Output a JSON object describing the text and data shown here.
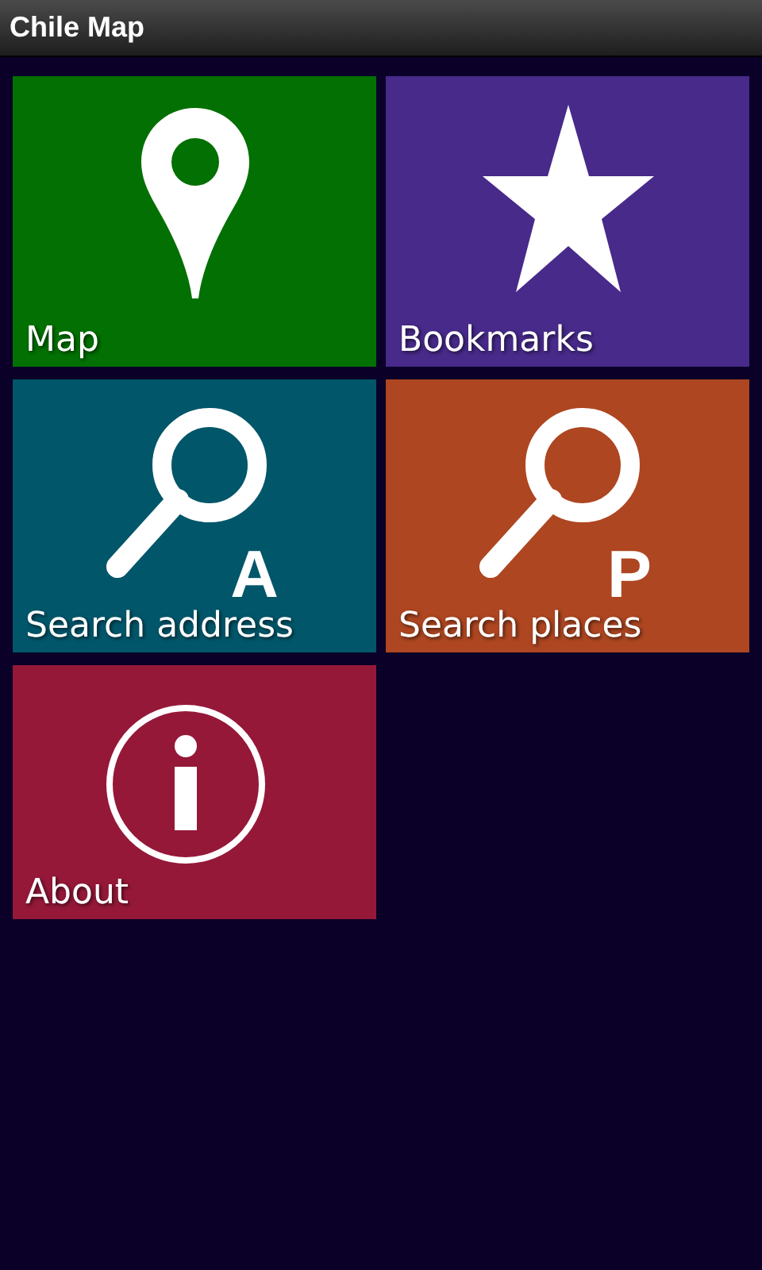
{
  "window": {
    "title": "Chile Map"
  },
  "tiles": [
    {
      "label": "Map",
      "kind": "pin",
      "color": "#027002"
    },
    {
      "label": "Bookmarks",
      "kind": "star",
      "color": "#472a8a"
    },
    {
      "label": "Search address",
      "kind": "search",
      "badge": "A",
      "color": "#01566a"
    },
    {
      "label": "Search places",
      "kind": "search",
      "badge": "P",
      "color": "#ad4621"
    },
    {
      "label": "About",
      "kind": "info",
      "color": "#951839"
    }
  ]
}
